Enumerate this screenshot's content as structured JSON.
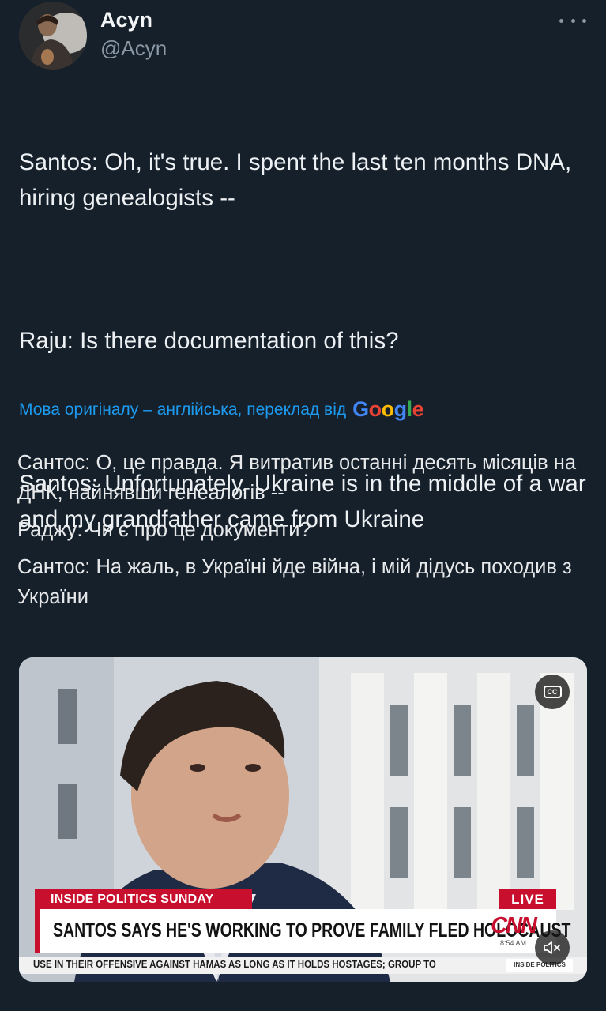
{
  "author": {
    "name": "Acyn",
    "handle": "@Acyn",
    "avatar_icon": "profile-photo"
  },
  "tweet": {
    "lines": [
      "Santos: Oh, it's true. I spent the last ten months DNA, hiring genealogists --",
      "Raju: Is there documentation of this?",
      "Santos: Unfortunately, Ukraine is in the middle of a war and my grandfather came from Ukraine"
    ]
  },
  "translation": {
    "note": "Мова оригіналу – англійська, переклад від",
    "provider_letters": [
      "G",
      "o",
      "o",
      "g",
      "l",
      "e"
    ],
    "lines": [
      "Сантос: О, це правда. Я витратив останні десять місяців на ДНК, найнявши генеалогів --",
      "Раджу: Чи є про це документи?",
      "Сантос: На жаль, в Україні йде війна, і мій дідусь походив з України"
    ]
  },
  "media": {
    "cc_label": "CC",
    "show_name": "INSIDE POLITICS SUNDAY",
    "live_label": "LIVE",
    "headline": "SANTOS SAYS HE'S WORKING TO PROVE FAMILY FLED HOLOCAUST",
    "network_logo": "CNN",
    "time": "8:54 AM",
    "ticker": "USE IN THEIR OFFENSIVE AGAINST HAMAS AS LONG AS IT HOLDS HOSTAGES; GROUP TO",
    "ticker_badge": "INSIDE POLITICS",
    "colors": {
      "cnn_red": "#c8102e",
      "link_blue": "#1d9bf0",
      "background": "#15202b"
    }
  }
}
